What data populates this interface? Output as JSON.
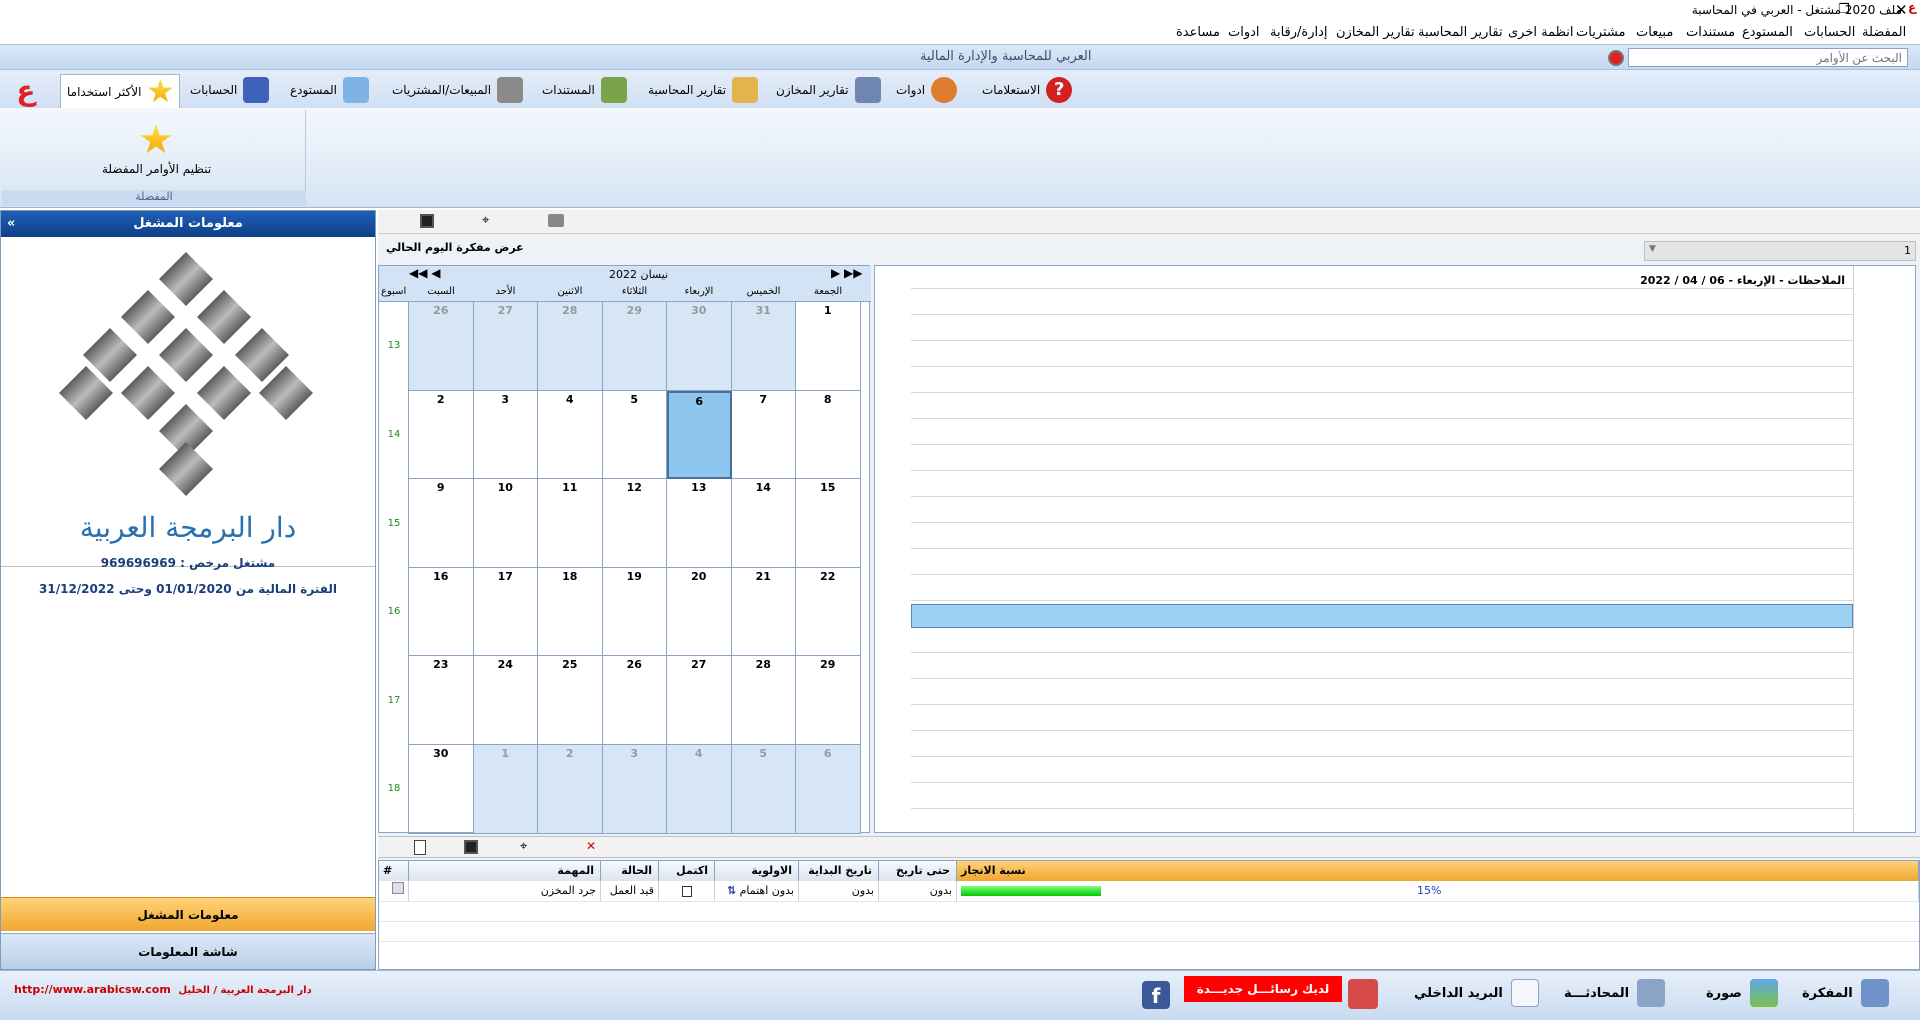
{
  "window": {
    "title": "ملف 2020 مشتغل - العربي في المحاسبة",
    "restore_glyph": "❐",
    "close_glyph": "✕"
  },
  "menu": [
    "المفضلة",
    "الحسابات",
    "المستودع",
    "مستندات",
    "مبيعات",
    "مشتريات",
    "انظمة اخرى",
    "تقارير المحاسبة",
    "تقارير المخازن",
    "إدارة/رقابة",
    "ادوات",
    "مساعدة"
  ],
  "caption": {
    "title": "العربي للمحاسبة والإدارة المالية",
    "search_placeholder": "البحث عن الأوامر"
  },
  "ribbon_tabs": [
    {
      "label": "الأكثر استخداما",
      "icon": "star-icon",
      "color": "#f3b400"
    },
    {
      "label": "الحسابات",
      "icon": "books-icon",
      "color": "#3f62b8"
    },
    {
      "label": "المستودع",
      "icon": "boxes-icon",
      "color": "#7fb3e6"
    },
    {
      "label": "المبيعات/المشتريات",
      "icon": "cart-icon",
      "color": "#8a8a8a"
    },
    {
      "label": "المستندات",
      "icon": "document-icon",
      "color": "#7aa34a"
    },
    {
      "label": "تقارير المحاسبة",
      "icon": "report-icon",
      "color": "#e2b54c"
    },
    {
      "label": "تقارير المخازن",
      "icon": "printer-icon",
      "color": "#6f86b0"
    },
    {
      "label": "ادوات",
      "icon": "tools-icon",
      "color": "#e07b2d"
    },
    {
      "label": "الاستعلامات",
      "icon": "help-icon",
      "color": "#d32020"
    }
  ],
  "favorites": {
    "label": "تنظيم الأوامر المفضلة",
    "group": "المفضلة"
  },
  "left_panel": {
    "title": "معلومات المشغل",
    "company": "دار البرمجة العربية",
    "licensed": "مشتغل مرخص : 969696969",
    "period": "الفترة المالية من   01/01/2020 وحتى 31/12/2022",
    "btn_operator": "معلومات المشغل",
    "btn_info": "شاشة المعلومات"
  },
  "main": {
    "show_today_label": "عرض مفكرة اليوم الحالي",
    "notes_header": "الملاحظات - الإربعاء - 06 / 04 / 2022",
    "combo_value": "1"
  },
  "calendar": {
    "month_label": "نيسان 2022",
    "week_label": "اسبوع",
    "day_names": [
      "السبت",
      "الأحد",
      "الاثنين",
      "الثلاثاء",
      "الإربعاء",
      "الخميس",
      "الجمعة"
    ],
    "weeks": [
      {
        "num": "13",
        "days": [
          {
            "d": "26",
            "o": true
          },
          {
            "d": "27",
            "o": true
          },
          {
            "d": "28",
            "o": true
          },
          {
            "d": "29",
            "o": true
          },
          {
            "d": "30",
            "o": true
          },
          {
            "d": "31",
            "o": true
          },
          {
            "d": "1",
            "o": false
          }
        ]
      },
      {
        "num": "14",
        "days": [
          {
            "d": "2",
            "o": false
          },
          {
            "d": "3",
            "o": false
          },
          {
            "d": "4",
            "o": false
          },
          {
            "d": "5",
            "o": false
          },
          {
            "d": "6",
            "o": false,
            "t": true
          },
          {
            "d": "7",
            "o": false
          },
          {
            "d": "8",
            "o": false
          }
        ]
      },
      {
        "num": "15",
        "days": [
          {
            "d": "9",
            "o": false
          },
          {
            "d": "10",
            "o": false
          },
          {
            "d": "11",
            "o": false
          },
          {
            "d": "12",
            "o": false
          },
          {
            "d": "13",
            "o": false
          },
          {
            "d": "14",
            "o": false
          },
          {
            "d": "15",
            "o": false
          }
        ]
      },
      {
        "num": "16",
        "days": [
          {
            "d": "16",
            "o": false
          },
          {
            "d": "17",
            "o": false
          },
          {
            "d": "18",
            "o": false
          },
          {
            "d": "19",
            "o": false
          },
          {
            "d": "20",
            "o": false
          },
          {
            "d": "21",
            "o": false
          },
          {
            "d": "22",
            "o": false
          }
        ]
      },
      {
        "num": "17",
        "days": [
          {
            "d": "23",
            "o": false
          },
          {
            "d": "24",
            "o": false
          },
          {
            "d": "25",
            "o": false
          },
          {
            "d": "26",
            "o": false
          },
          {
            "d": "27",
            "o": false
          },
          {
            "d": "28",
            "o": false
          },
          {
            "d": "29",
            "o": false
          }
        ]
      },
      {
        "num": "18",
        "days": [
          {
            "d": "30",
            "o": false
          },
          {
            "d": "1",
            "o": true
          },
          {
            "d": "2",
            "o": true
          },
          {
            "d": "3",
            "o": true
          },
          {
            "d": "4",
            "o": true
          },
          {
            "d": "5",
            "o": true
          },
          {
            "d": "6",
            "o": true
          }
        ]
      }
    ]
  },
  "tasks": {
    "columns": [
      "#",
      "المهمة",
      "الحالة",
      "اكتمل",
      "الاولوية",
      "تاريخ البداية",
      "حتى تاريخ",
      "نسبة الانجاز"
    ],
    "row": {
      "task": "جرد المخزن",
      "status": "قيد العمل",
      "priority": "بدون اهتمام",
      "start": "بدون",
      "end": "بدون",
      "progress": 0.15,
      "progress_label": "15%"
    }
  },
  "footer": {
    "url": "http://www.arabicsw.com",
    "credit": "دار البرمجة العربية / الخليل",
    "notebook": "المفكرة",
    "picture": "صورة",
    "chat": "المحادثـــة",
    "mail": "البريد الداخلي",
    "new_messages": "لديك رسائـــل جديـــدة"
  }
}
